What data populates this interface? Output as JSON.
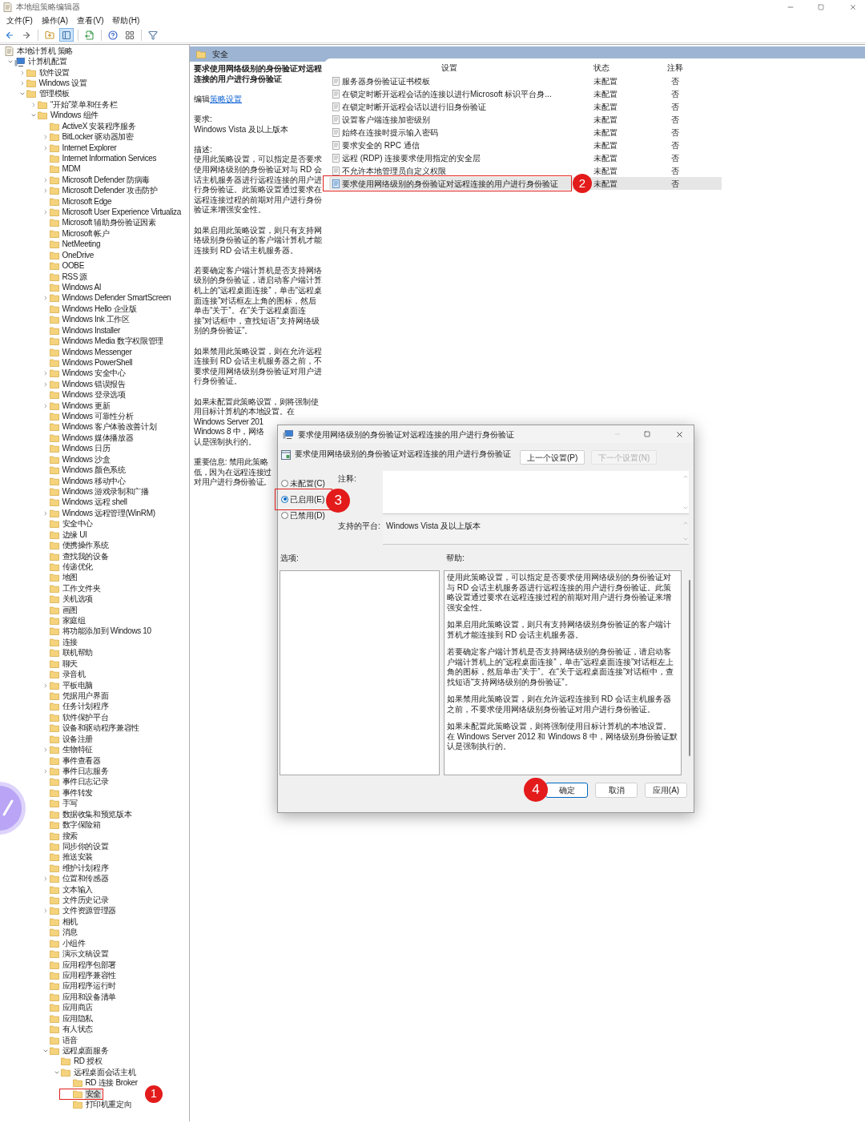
{
  "window": {
    "title": "本地组策略编辑器"
  },
  "menu": [
    "文件(F)",
    "操作(A)",
    "查看(V)",
    "帮助(H)"
  ],
  "toolbar": [
    {
      "kind": "back",
      "pressed": false
    },
    {
      "kind": "forward",
      "pressed": false
    },
    {
      "kind": "up",
      "pressed": false
    },
    {
      "kind": "tree",
      "pressed": true
    },
    {
      "kind": "export",
      "pressed": false
    },
    {
      "kind": "help",
      "pressed": false
    },
    {
      "kind": "view",
      "pressed": false
    },
    {
      "kind": "filter",
      "pressed": false
    }
  ],
  "tree": [
    {
      "label": "本地计算机 策略",
      "kind": "root",
      "selected": false,
      "children": [
        {
          "label": "计算机配置",
          "kind": "computer",
          "selected": false,
          "expanded": true,
          "children": [
            {
              "label": "软件设置",
              "selected": false,
              "expanded": false
            },
            {
              "label": "Windows 设置",
              "selected": false,
              "expanded": false
            },
            {
              "label": "管理模板",
              "selected": false,
              "expanded": true,
              "children": [
                {
                  "label": "“开始”菜单和任务栏",
                  "selected": false,
                  "expanded": false
                },
                {
                  "label": "Windows 组件",
                  "selected": false,
                  "expanded": true,
                  "children": [
                    {
                      "label": "ActiveX 安装程序服务",
                      "selected": false
                    },
                    {
                      "label": "BitLocker 驱动器加密",
                      "selected": false,
                      "expanded": false
                    },
                    {
                      "label": "Internet Explorer",
                      "selected": false,
                      "expanded": false
                    },
                    {
                      "label": "Internet Information Services",
                      "selected": false
                    },
                    {
                      "label": "MDM",
                      "selected": false
                    },
                    {
                      "label": "Microsoft Defender 防病毒",
                      "selected": false,
                      "expanded": false
                    },
                    {
                      "label": "Microsoft Defender 攻击防护",
                      "selected": false,
                      "expanded": false
                    },
                    {
                      "label": "Microsoft Edge",
                      "selected": false
                    },
                    {
                      "label": "Microsoft User Experience Virtualiza",
                      "selected": false,
                      "expanded": false
                    },
                    {
                      "label": "Microsoft 辅助身份验证因素",
                      "selected": false
                    },
                    {
                      "label": "Microsoft 帐户",
                      "selected": false
                    },
                    {
                      "label": "NetMeeting",
                      "selected": false
                    },
                    {
                      "label": "OneDrive",
                      "selected": false
                    },
                    {
                      "label": "OOBE",
                      "selected": false
                    },
                    {
                      "label": "RSS 源",
                      "selected": false
                    },
                    {
                      "label": "Windows AI",
                      "selected": false
                    },
                    {
                      "label": "Windows Defender SmartScreen",
                      "selected": false,
                      "expanded": false
                    },
                    {
                      "label": "Windows Hello 企业版",
                      "selected": false
                    },
                    {
                      "label": "Windows Ink 工作区",
                      "selected": false
                    },
                    {
                      "label": "Windows Installer",
                      "selected": false
                    },
                    {
                      "label": "Windows Media 数字权限管理",
                      "selected": false
                    },
                    {
                      "label": "Windows Messenger",
                      "selected": false
                    },
                    {
                      "label": "Windows PowerShell",
                      "selected": false
                    },
                    {
                      "label": "Windows 安全中心",
                      "selected": false,
                      "expanded": false
                    },
                    {
                      "label": "Windows 错误报告",
                      "selected": false,
                      "expanded": false
                    },
                    {
                      "label": "Windows 登录选项",
                      "selected": false
                    },
                    {
                      "label": "Windows 更新",
                      "selected": false,
                      "expanded": false
                    },
                    {
                      "label": "Windows 可靠性分析",
                      "selected": false
                    },
                    {
                      "label": "Windows 客户体验改善计划",
                      "selected": false
                    },
                    {
                      "label": "Windows 媒体播放器",
                      "selected": false
                    },
                    {
                      "label": "Windows 日历",
                      "selected": false
                    },
                    {
                      "label": "Windows 沙盒",
                      "selected": false
                    },
                    {
                      "label": "Windows 颜色系统",
                      "selected": false
                    },
                    {
                      "label": "Windows 移动中心",
                      "selected": false
                    },
                    {
                      "label": "Windows 游戏录制和广播",
                      "selected": false
                    },
                    {
                      "label": "Windows 远程 shell",
                      "selected": false
                    },
                    {
                      "label": "Windows 远程管理(WinRM)",
                      "selected": false,
                      "expanded": false
                    },
                    {
                      "label": "安全中心",
                      "selected": false
                    },
                    {
                      "label": "边缘 UI",
                      "selected": false
                    },
                    {
                      "label": "便携操作系统",
                      "selected": false
                    },
                    {
                      "label": "查找我的设备",
                      "selected": false
                    },
                    {
                      "label": "传递优化",
                      "selected": false
                    },
                    {
                      "label": "地图",
                      "selected": false
                    },
                    {
                      "label": "工作文件夹",
                      "selected": false
                    },
                    {
                      "label": "关机选项",
                      "selected": false
                    },
                    {
                      "label": "画图",
                      "selected": false
                    },
                    {
                      "label": "家庭组",
                      "selected": false
                    },
                    {
                      "label": "将功能添加到 Windows 10",
                      "selected": false
                    },
                    {
                      "label": "连接",
                      "selected": false
                    },
                    {
                      "label": "联机帮助",
                      "selected": false
                    },
                    {
                      "label": "聊天",
                      "selected": false
                    },
                    {
                      "label": "录音机",
                      "selected": false
                    },
                    {
                      "label": "平板电脑",
                      "selected": false,
                      "expanded": false
                    },
                    {
                      "label": "凭据用户界面",
                      "selected": false
                    },
                    {
                      "label": "任务计划程序",
                      "selected": false
                    },
                    {
                      "label": "软件保护平台",
                      "selected": false
                    },
                    {
                      "label": "设备和驱动程序兼容性",
                      "selected": false
                    },
                    {
                      "label": "设备注册",
                      "selected": false
                    },
                    {
                      "label": "生物特征",
                      "selected": false,
                      "expanded": false
                    },
                    {
                      "label": "事件查看器",
                      "selected": false
                    },
                    {
                      "label": "事件日志服务",
                      "selected": false,
                      "expanded": false
                    },
                    {
                      "label": "事件日志记录",
                      "selected": false
                    },
                    {
                      "label": "事件转发",
                      "selected": false
                    },
                    {
                      "label": "手写",
                      "selected": false
                    },
                    {
                      "label": "数据收集和预览版本",
                      "selected": false
                    },
                    {
                      "label": "数字保险箱",
                      "selected": false
                    },
                    {
                      "label": "搜索",
                      "selected": false
                    },
                    {
                      "label": "同步你的设置",
                      "selected": false
                    },
                    {
                      "label": "推送安装",
                      "selected": false
                    },
                    {
                      "label": "维护计划程序",
                      "selected": false
                    },
                    {
                      "label": "位置和传感器",
                      "selected": false,
                      "expanded": false
                    },
                    {
                      "label": "文本输入",
                      "selected": false
                    },
                    {
                      "label": "文件历史记录",
                      "selected": false
                    },
                    {
                      "label": "文件资源管理器",
                      "selected": false,
                      "expanded": false
                    },
                    {
                      "label": "相机",
                      "selected": false
                    },
                    {
                      "label": "消息",
                      "selected": false
                    },
                    {
                      "label": "小组件",
                      "selected": false
                    },
                    {
                      "label": "演示文稿设置",
                      "selected": false
                    },
                    {
                      "label": "应用程序包部署",
                      "selected": false
                    },
                    {
                      "label": "应用程序兼容性",
                      "selected": false
                    },
                    {
                      "label": "应用程序运行时",
                      "selected": false
                    },
                    {
                      "label": "应用和设备清单",
                      "selected": false
                    },
                    {
                      "label": "应用商店",
                      "selected": false
                    },
                    {
                      "label": "应用隐私",
                      "selected": false
                    },
                    {
                      "label": "有人状态",
                      "selected": false
                    },
                    {
                      "label": "语音",
                      "selected": false
                    },
                    {
                      "label": "远程桌面服务",
                      "selected": false,
                      "expanded": true,
                      "children": [
                        {
                          "label": "RD 授权",
                          "selected": false
                        },
                        {
                          "label": "远程桌面会话主机",
                          "selected": false,
                          "expanded": true,
                          "children": [
                            {
                              "label": "RD 连接 Broker",
                              "selected": false
                            },
                            {
                              "label": "安全",
                              "selected": true,
                              "callout": {
                                "label": "1",
                                "outlined": true
                              }
                            },
                            {
                              "label": "打印机重定向",
                              "selected": false
                            }
                          ]
                        }
                      ]
                    }
                  ]
                }
              ]
            }
          ]
        }
      ]
    }
  ],
  "details": {
    "header": "安全",
    "title": "要求使用网络级别的身份验证对远程连接的用户进行身份验证",
    "edit_prefix": "编辑",
    "edit_link": "策略设置",
    "requirement_label": "要求:",
    "requirement": "Windows Vista 及以上版本",
    "description_label": "描述:",
    "paragraphs": [
      {
        "kind": "text",
        "text": "使用此策略设置，可以指定是否要求使用网络级别的身份验证对与 RD 会话主机服务器进行远程连接的用户进行身份验证。此策略设置通过要求在远程连接过程的前期对用户进行身份验证来增强安全性。"
      },
      {
        "kind": "text",
        "text": "如果启用此策略设置，则只有支持网络级别身份验证的客户端计算机才能连接到 RD 会话主机服务器。"
      },
      {
        "kind": "text",
        "text": "若要确定客户端计算机是否支持网络级别的身份验证，请启动客户端计算机上的“远程桌面连接”，单击“远程桌面连接”对话框左上角的图标，然后单击“关于”。在“关于远程桌面连接”对话框中，查找短语“支持网络级别的身份验证”。"
      },
      {
        "kind": "text",
        "text": "如果禁用此策略设置，则在允许远程连接到 RD 会话主机服务器之前，不要求使用网络级别身份验证对用户进行身份验证。"
      },
      {
        "kind": "lines",
        "lines": [
          "如果未配置此策略设置，则将强制使",
          "用目标计算机的本地设置。在",
          "Windows Server 201",
          "Windows 8 中，网络",
          "认是强制执行的。"
        ]
      },
      {
        "kind": "lines",
        "lines": [
          "重要信息: 禁用此策略",
          "低，因为在远程连接过",
          "对用户进行身份验证。"
        ]
      }
    ]
  },
  "list": {
    "columns": [
      "设置",
      "状态",
      "注释"
    ],
    "rows": [
      {
        "setting": "服务器身份验证证书模板",
        "status": "未配置",
        "comment": "否",
        "selected": false
      },
      {
        "setting": "在锁定时断开远程会话的连接以进行Microsoft 标识平台身...",
        "status": "未配置",
        "comment": "否",
        "selected": false
      },
      {
        "setting": "在锁定时断开远程会话以进行旧身份验证",
        "status": "未配置",
        "comment": "否",
        "selected": false
      },
      {
        "setting": "设置客户端连接加密级别",
        "status": "未配置",
        "comment": "否",
        "selected": false
      },
      {
        "setting": "始终在连接时提示输入密码",
        "status": "未配置",
        "comment": "否",
        "selected": false
      },
      {
        "setting": "要求安全的 RPC 通信",
        "status": "未配置",
        "comment": "否",
        "selected": false
      },
      {
        "setting": "远程 (RDP) 连接要求使用指定的安全层",
        "status": "未配置",
        "comment": "否",
        "selected": false
      },
      {
        "setting": "不允许本地管理员自定义权限",
        "status": "未配置",
        "comment": "否",
        "selected": false
      },
      {
        "setting": "要求使用网络级别的身份验证对远程连接的用户进行身份验证",
        "status": "未配置",
        "comment": "否",
        "selected": true,
        "callout": {
          "label": "2",
          "outlined": true
        }
      }
    ]
  },
  "dialog": {
    "title": "要求使用网络级别的身份验证对远程连接的用户进行身份验证",
    "heading": "要求使用网络级别的身份验证对远程连接的用户进行身份验证",
    "nav_buttons": [
      {
        "label": "上一个设置(P)",
        "disabled": false
      },
      {
        "label": "下一个设置(N)",
        "disabled": true
      }
    ],
    "options": [
      {
        "label": "未配置(C)",
        "selected": false
      },
      {
        "label": "已启用(E)",
        "selected": true,
        "callout": {
          "label": "3",
          "outlined": true
        }
      },
      {
        "label": "已禁用(D)",
        "selected": false
      }
    ],
    "comment_label": "注释:",
    "platform_label": "支持的平台:",
    "platform": "Windows Vista 及以上版本",
    "options_label": "选项:",
    "help_label": "帮助:",
    "help": [
      "使用此策略设置，可以指定是否要求使用网络级别的身份验证对与 RD 会话主机服务器进行远程连接的用户进行身份验证。此策略设置通过要求在远程连接过程的前期对用户进行身份验证来增强安全性。",
      "如果启用此策略设置，则只有支持网络级别身份验证的客户端计算机才能连接到 RD 会话主机服务器。",
      "若要确定客户端计算机是否支持网络级别的身份验证，请启动客户端计算机上的“远程桌面连接”，单击“远程桌面连接”对话框左上角的图标，然后单击“关于”。在“关于远程桌面连接”对话框中，查找短语“支持网络级别的身份验证”。",
      "如果禁用此策略设置，则在允许远程连接到 RD 会话主机服务器之前，不要求使用网络级别身份验证对用户进行身份验证。",
      "如果未配置此策略设置，则将强制使用目标计算机的本地设置。在 Windows Server 2012 和 Windows 8 中，网络级别身份验证默认是强制执行的。"
    ],
    "buttons": [
      {
        "label": "确定",
        "default": true,
        "callout": {
          "label": "4",
          "outlined": false
        }
      },
      {
        "label": "取消",
        "default": false
      },
      {
        "label": "应用(A)",
        "default": false
      }
    ]
  }
}
